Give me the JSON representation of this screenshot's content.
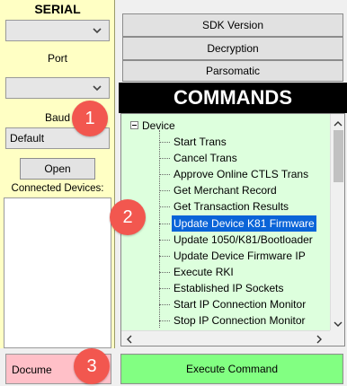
{
  "serial": {
    "heading": "SERIAL",
    "port_label": "Port",
    "baud_label": "Baud",
    "baud_value": "Default",
    "open_label": "Open",
    "connected_label": "Connected Devices:"
  },
  "actions": {
    "sdk_version": "SDK Version",
    "decryption": "Decryption",
    "parsomatic": "Parsomatic"
  },
  "commands": {
    "title": "COMMANDS",
    "root": "Device",
    "items": [
      "Start Trans",
      "Cancel Trans",
      "Approve Online CTLS Trans",
      "Get Merchant Record",
      "Get Transaction Results",
      "Update Device K81 Firmware",
      "Update 1050/K81/Bootloader",
      "Update Device Firmware IP",
      "Execute RKI",
      "Established IP Sockets",
      "Start IP Connection Monitor",
      "Stop IP Connection Monitor"
    ],
    "selected_index": 5
  },
  "bottom": {
    "documentation": "Docume",
    "execute": "Execute Command"
  },
  "badges": [
    "1",
    "2",
    "3"
  ],
  "icons": {
    "chevron": "chevron-down-icon",
    "expander": "minus-box-icon"
  },
  "colors": {
    "left_panel": "#ffffc4",
    "tree_bg": "#ddffdd",
    "selection": "#0a64d8",
    "execute": "#82ff82",
    "doc": "#ffc0c8",
    "badge": "#f2574f"
  }
}
